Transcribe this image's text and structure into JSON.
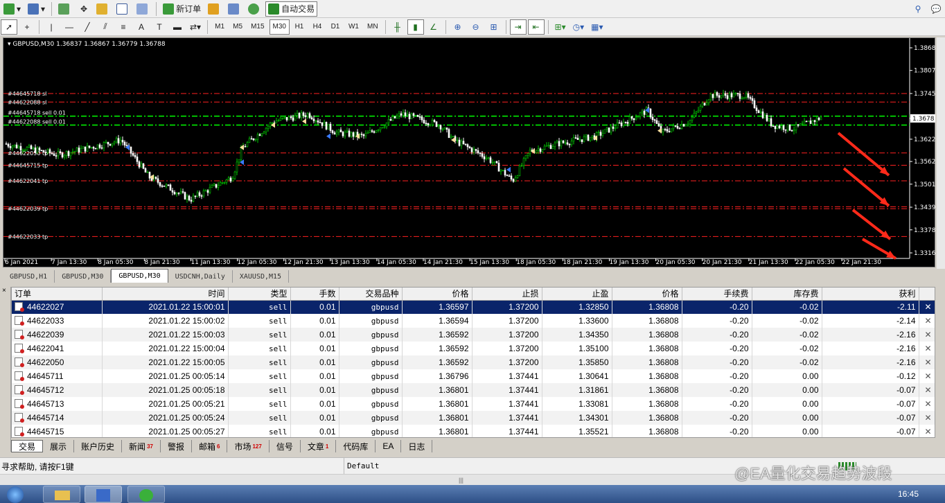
{
  "toolbar1": {
    "new_order_label": "新订单",
    "auto_trade_label": "自动交易"
  },
  "toolbar2": {
    "timeframes": [
      "M1",
      "M5",
      "M15",
      "M30",
      "H1",
      "H4",
      "D1",
      "W1",
      "MN"
    ],
    "active_timeframe": "M30"
  },
  "chart": {
    "header": "GBPUSD,M30  1.36837 1.36867 1.36779 1.36788",
    "price_ticks": [
      "1.3868",
      "1.3807",
      "1.3745",
      "1.3678",
      "1.3622",
      "1.3562",
      "1.3501",
      "1.3439",
      "1.3378",
      "1.3316"
    ],
    "current_price": "1.3678",
    "time_ticks": [
      "6 Jan 2021",
      "7 Jan 13:30",
      "8 Jan 05:30",
      "8 Jan 21:30",
      "11 Jan 13:30",
      "12 Jan 05:30",
      "12 Jan 21:30",
      "13 Jan 13:30",
      "14 Jan 05:30",
      "14 Jan 21:30",
      "15 Jan 13:30",
      "18 Jan 05:30",
      "18 Jan 21:30",
      "19 Jan 13:30",
      "20 Jan 05:30",
      "20 Jan 21:30",
      "21 Jan 13:30",
      "22 Jan 05:30",
      "22 Jan 21:30"
    ],
    "line_labels": [
      {
        "text": "#44645718 sl",
        "kind": "sl"
      },
      {
        "text": "#44622088 sl",
        "kind": "sl"
      },
      {
        "text": "#44645718 sell 0.01",
        "kind": "entry"
      },
      {
        "text": "#44622088 sell 0.01",
        "kind": "entry"
      },
      {
        "text": "#44622050 tp",
        "kind": "tp"
      },
      {
        "text": "#44645715 tp",
        "kind": "tp"
      },
      {
        "text": "#44622041 tp",
        "kind": "tp"
      },
      {
        "text": "#44622039 tp",
        "kind": "tp"
      },
      {
        "text": "#44622033 tp",
        "kind": "tp"
      }
    ],
    "colors": {
      "bull": "#00c800",
      "bear": "#ffffff",
      "sl_line": "#ff2020",
      "entry_line": "#00ff00",
      "arrow": "#ff2a1a"
    }
  },
  "chart_tabs": [
    "GBPUSD,H1",
    "GBPUSD,M30",
    "GBPUSD,M30",
    "USDCNH,Daily",
    "XAUUSD,M15"
  ],
  "active_chart_tab": 2,
  "orders": {
    "columns": [
      "订单",
      "时间",
      "类型",
      "手数",
      "交易品种",
      "价格",
      "止损",
      "止盈",
      "价格",
      "手续费",
      "库存费",
      "获利"
    ],
    "rows": [
      [
        "44622027",
        "2021.01.22 15:00:01",
        "sell",
        "0.01",
        "gbpusd",
        "1.36597",
        "1.37200",
        "1.32850",
        "1.36808",
        "-0.20",
        "-0.02",
        "-2.11"
      ],
      [
        "44622033",
        "2021.01.22 15:00:02",
        "sell",
        "0.01",
        "gbpusd",
        "1.36594",
        "1.37200",
        "1.33600",
        "1.36808",
        "-0.20",
        "-0.02",
        "-2.14"
      ],
      [
        "44622039",
        "2021.01.22 15:00:03",
        "sell",
        "0.01",
        "gbpusd",
        "1.36592",
        "1.37200",
        "1.34350",
        "1.36808",
        "-0.20",
        "-0.02",
        "-2.16"
      ],
      [
        "44622041",
        "2021.01.22 15:00:04",
        "sell",
        "0.01",
        "gbpusd",
        "1.36592",
        "1.37200",
        "1.35100",
        "1.36808",
        "-0.20",
        "-0.02",
        "-2.16"
      ],
      [
        "44622050",
        "2021.01.22 15:00:05",
        "sell",
        "0.01",
        "gbpusd",
        "1.36592",
        "1.37200",
        "1.35850",
        "1.36808",
        "-0.20",
        "-0.02",
        "-2.16"
      ],
      [
        "44645711",
        "2021.01.25 00:05:14",
        "sell",
        "0.01",
        "gbpusd",
        "1.36796",
        "1.37441",
        "1.30641",
        "1.36808",
        "-0.20",
        "0.00",
        "-0.12"
      ],
      [
        "44645712",
        "2021.01.25 00:05:18",
        "sell",
        "0.01",
        "gbpusd",
        "1.36801",
        "1.37441",
        "1.31861",
        "1.36808",
        "-0.20",
        "0.00",
        "-0.07"
      ],
      [
        "44645713",
        "2021.01.25 00:05:21",
        "sell",
        "0.01",
        "gbpusd",
        "1.36801",
        "1.37441",
        "1.33081",
        "1.36808",
        "-0.20",
        "0.00",
        "-0.07"
      ],
      [
        "44645714",
        "2021.01.25 00:05:24",
        "sell",
        "0.01",
        "gbpusd",
        "1.36801",
        "1.37441",
        "1.34301",
        "1.36808",
        "-0.20",
        "0.00",
        "-0.07"
      ],
      [
        "44645715",
        "2021.01.25 00:05:27",
        "sell",
        "0.01",
        "gbpusd",
        "1.36801",
        "1.37441",
        "1.35521",
        "1.36808",
        "-0.20",
        "0.00",
        "-0.07"
      ]
    ]
  },
  "terminal_tabs": [
    {
      "label": "交易",
      "badge": ""
    },
    {
      "label": "展示",
      "badge": ""
    },
    {
      "label": "账户历史",
      "badge": ""
    },
    {
      "label": "新闻",
      "badge": "37"
    },
    {
      "label": "警报",
      "badge": ""
    },
    {
      "label": "邮箱",
      "badge": "6"
    },
    {
      "label": "市场",
      "badge": "127"
    },
    {
      "label": "信号",
      "badge": ""
    },
    {
      "label": "文章",
      "badge": "1"
    },
    {
      "label": "代码库",
      "badge": ""
    },
    {
      "label": "EA",
      "badge": ""
    },
    {
      "label": "日志",
      "badge": ""
    }
  ],
  "status": {
    "help": "寻求帮助, 请按F1键",
    "profile": "Default",
    "watermark": "@EA量化交易趋势波段"
  },
  "taskbar": {
    "clock": "16:45"
  }
}
